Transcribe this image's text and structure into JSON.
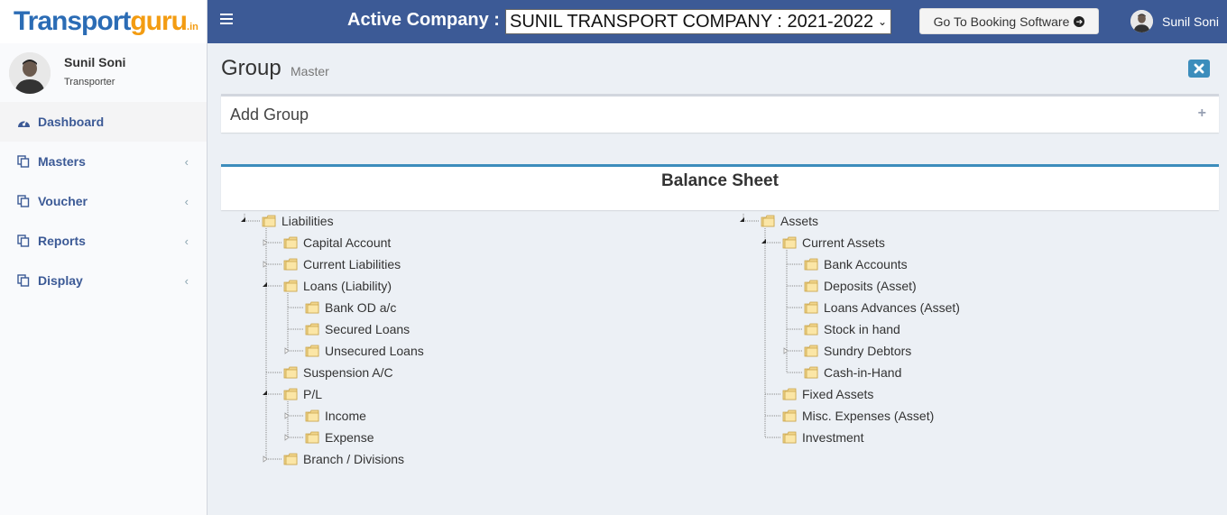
{
  "brand": {
    "part1": "Transport",
    "part2": "guru",
    "suffix": ".in"
  },
  "sidebar": {
    "user": {
      "name": "Sunil Soni",
      "role": "Transporter"
    },
    "items": [
      {
        "label": "Dashboard",
        "icon": "dashboard-icon"
      },
      {
        "label": "Masters",
        "icon": "copy-icon"
      },
      {
        "label": "Voucher",
        "icon": "copy-icon"
      },
      {
        "label": "Reports",
        "icon": "copy-icon"
      },
      {
        "label": "Display",
        "icon": "copy-icon"
      }
    ]
  },
  "header": {
    "active_label": "Active Company :",
    "company_value": "SUNIL TRANSPORT COMPANY : 2021-2022",
    "booking_button": "Go To Booking Software",
    "user_name": "Sunil Soni"
  },
  "page": {
    "title": "Group",
    "subtitle": "Master"
  },
  "add_group": {
    "title": "Add Group"
  },
  "balance_sheet": {
    "title": "Balance Sheet",
    "liabilities": {
      "label": "Liabilities",
      "children": [
        {
          "label": "Capital Account"
        },
        {
          "label": "Current Liabilities"
        },
        {
          "label": "Loans (Liability)",
          "children": [
            {
              "label": "Bank OD a/c"
            },
            {
              "label": "Secured Loans"
            },
            {
              "label": "Unsecured Loans"
            }
          ]
        },
        {
          "label": "Suspension A/C"
        },
        {
          "label": "P/L",
          "children": [
            {
              "label": "Income"
            },
            {
              "label": "Expense"
            }
          ]
        },
        {
          "label": "Branch / Divisions"
        }
      ]
    },
    "assets": {
      "label": "Assets",
      "children": [
        {
          "label": "Current Assets",
          "children": [
            {
              "label": "Bank Accounts"
            },
            {
              "label": "Deposits (Asset)"
            },
            {
              "label": "Loans Advances (Asset)"
            },
            {
              "label": "Stock in hand"
            },
            {
              "label": "Sundry Debtors"
            },
            {
              "label": "Cash-in-Hand"
            }
          ]
        },
        {
          "label": "Fixed Assets"
        },
        {
          "label": "Misc. Expenses (Asset)"
        },
        {
          "label": "Investment"
        }
      ]
    }
  },
  "colors": {
    "header": "#3c5a96",
    "accent": "#3c8dbc",
    "brand_blue": "#2b6cb5",
    "brand_orange": "#f39c12"
  }
}
